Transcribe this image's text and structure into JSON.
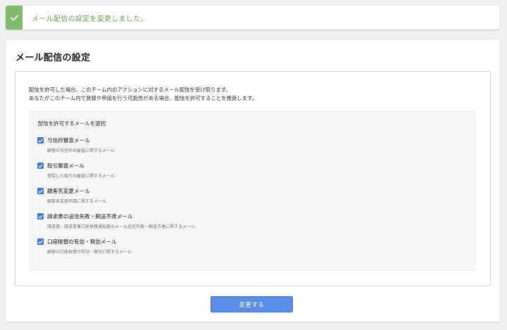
{
  "alert": {
    "icon": "check-icon",
    "message": "メール配信の設定を変更しました。",
    "color": "#7fb96b"
  },
  "page": {
    "title": "メール配信の設定",
    "description_lines": [
      "配信を許可した場合、このチーム内のアクションに対するメール配信を受け取ります。",
      "あなたがこのチーム内で登録や申請を行う可能性がある場合、配信を許可することを推奨します。"
    ]
  },
  "selection": {
    "heading": "配信を許可するメールを選択",
    "options": [
      {
        "label": "与信枠審査メール",
        "description": "顧客の与信枠の審査に関するメール",
        "checked": true
      },
      {
        "label": "取引審査メール",
        "description": "登録した取引の審査に関するメール",
        "checked": true
      },
      {
        "label": "顧客名変更メール",
        "description": "顧客名変更申請に関するメール",
        "checked": true
      },
      {
        "label": "請求書の送信失敗・郵送不達メール",
        "description": "請求書、請求書兼口座振替通知書のメール送信失敗・郵送不達に関するメール",
        "checked": true
      },
      {
        "label": "口座振替の有効・無効メール",
        "description": "顧客の口座振替の有効・無効に関するメール",
        "checked": true
      }
    ]
  },
  "submit_button": {
    "label": "変更する",
    "color": "#5a8ee6"
  }
}
